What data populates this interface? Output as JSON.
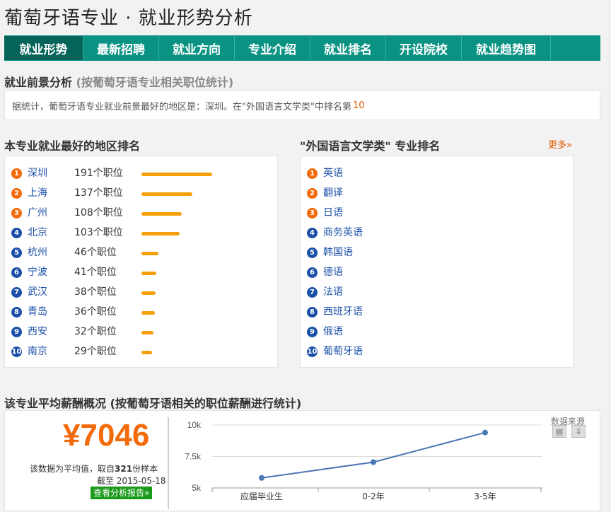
{
  "page_title": "葡萄牙语专业 · 就业形势分析",
  "nav": {
    "tabs": [
      {
        "label": "就业形势",
        "active": true
      },
      {
        "label": "最新招聘",
        "active": false
      },
      {
        "label": "就业方向",
        "active": false
      },
      {
        "label": "专业介绍",
        "active": false
      },
      {
        "label": "就业排名",
        "active": false
      },
      {
        "label": "开设院校",
        "active": false
      },
      {
        "label": "就业趋势图",
        "active": false
      }
    ]
  },
  "outlook": {
    "heading": "就业前景分析",
    "subheading": "(按葡萄牙语专业相关职位统计)",
    "summary_text": "据统计，葡萄牙语专业就业前景最好的地区是：深圳。在\"外国语言文学类\"中排名第",
    "summary_rank": "10"
  },
  "region_ranking": {
    "heading": "本专业就业最好的地区排名",
    "max_count": 191,
    "items": [
      {
        "rank": "1",
        "city": "深圳",
        "count": 191,
        "count_label": "191个职位"
      },
      {
        "rank": "2",
        "city": "上海",
        "count": 137,
        "count_label": "137个职位"
      },
      {
        "rank": "3",
        "city": "广州",
        "count": 108,
        "count_label": "108个职位"
      },
      {
        "rank": "4",
        "city": "北京",
        "count": 103,
        "count_label": "103个职位"
      },
      {
        "rank": "5",
        "city": "杭州",
        "count": 46,
        "count_label": "46个职位"
      },
      {
        "rank": "6",
        "city": "宁波",
        "count": 41,
        "count_label": "41个职位"
      },
      {
        "rank": "7",
        "city": "武汉",
        "count": 38,
        "count_label": "38个职位"
      },
      {
        "rank": "8",
        "city": "青岛",
        "count": 36,
        "count_label": "36个职位"
      },
      {
        "rank": "9",
        "city": "西安",
        "count": 32,
        "count_label": "32个职位"
      },
      {
        "rank": "10",
        "city": "南京",
        "count": 29,
        "count_label": "29个职位"
      }
    ]
  },
  "major_ranking": {
    "heading": "\"外国语言文学类\" 专业排名",
    "more_label": "更多»",
    "items": [
      {
        "rank": "1",
        "name": "英语"
      },
      {
        "rank": "2",
        "name": "翻译"
      },
      {
        "rank": "3",
        "name": "日语"
      },
      {
        "rank": "4",
        "name": "商务英语"
      },
      {
        "rank": "5",
        "name": "韩国语"
      },
      {
        "rank": "6",
        "name": "德语"
      },
      {
        "rank": "7",
        "name": "法语"
      },
      {
        "rank": "8",
        "name": "西班牙语"
      },
      {
        "rank": "9",
        "name": "俄语"
      },
      {
        "rank": "10",
        "name": "葡萄牙语"
      }
    ]
  },
  "salary": {
    "heading": "该专业平均薪酬概况 (按葡萄牙语相关的职位薪酬进行统计)",
    "value": "¥7046",
    "note_prefix": "该数据为平均值，取自",
    "sample_count": "321",
    "note_suffix": "份样本",
    "date_label": "截至 2015-05-18",
    "report_button": "查看分析报告»",
    "data_source_label": "数据来源",
    "icons": [
      "print-icon",
      "download-icon"
    ]
  },
  "colors": {
    "nav_bg": "#0a9383",
    "nav_active": "#05645a",
    "accent_orange": "#f26a0a",
    "bar_orange": "#f5a00a",
    "link_blue": "#1a4fa8",
    "line_color": "#4a77b4"
  },
  "chart_data": {
    "type": "line",
    "categories": [
      "应届毕业生",
      "0-2年",
      "3-5年"
    ],
    "values": [
      5800,
      7050,
      9400
    ],
    "ytick_labels": [
      "10k",
      "7.5k",
      "5k"
    ],
    "yticks": [
      10000,
      7500,
      5000
    ],
    "ylim": [
      5000,
      10000
    ],
    "grid": true
  }
}
